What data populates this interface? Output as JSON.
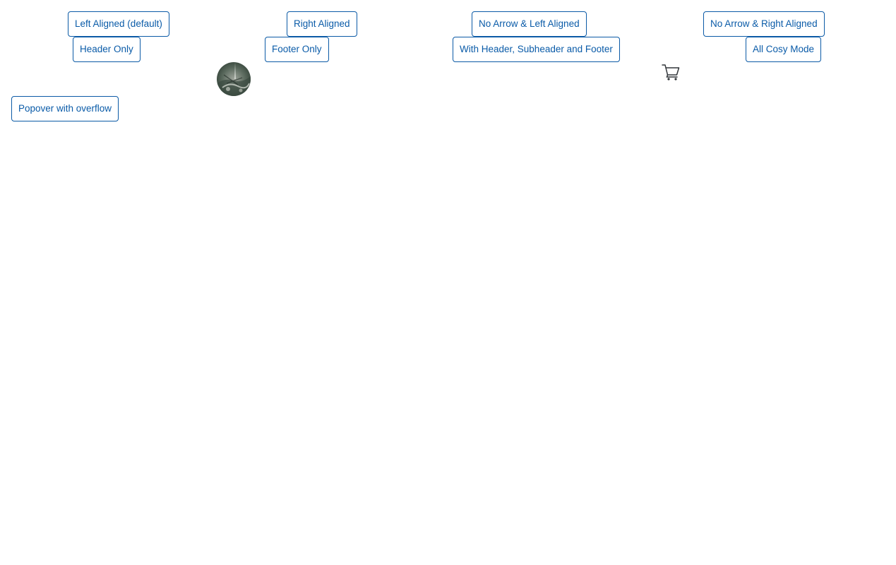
{
  "buttons": {
    "left_aligned": "Left Aligned (default)",
    "right_aligned": "Right Aligned",
    "no_arrow_left": "No Arrow & Left Aligned",
    "no_arrow_right": "No Arrow & Right Aligned",
    "header_only": "Header Only",
    "footer_only": "Footer Only",
    "header_subheader_footer": "With Header, Subheader and Footer",
    "all_cosy": "All Cosy Mode",
    "overflow": "Popover with overflow"
  },
  "icons": {
    "avatar": "avatar-image",
    "cart": "cart-icon"
  },
  "colors": {
    "accent": "#0a5ba8",
    "background": "#ffffff"
  }
}
